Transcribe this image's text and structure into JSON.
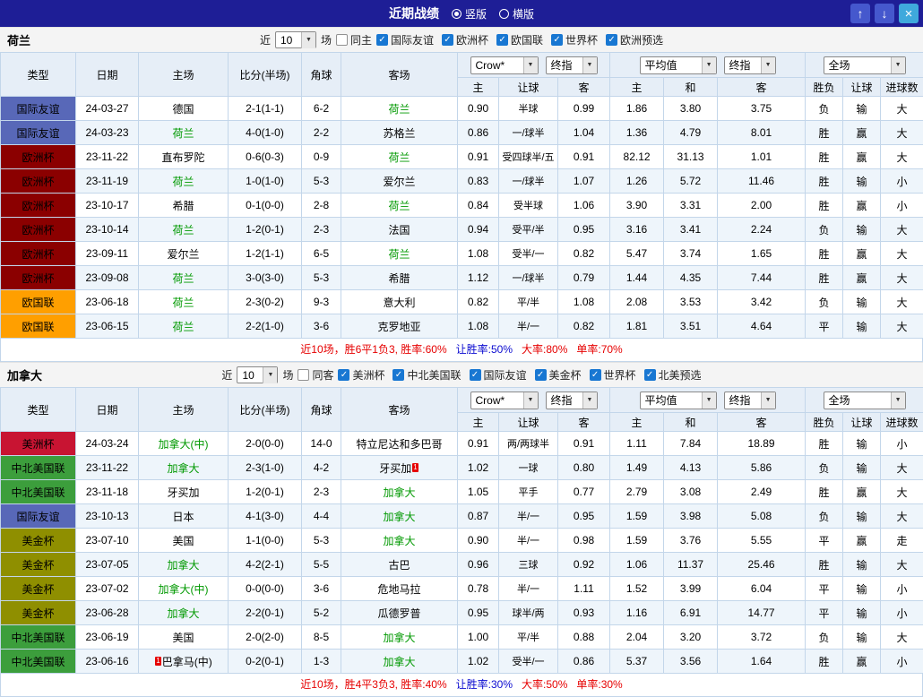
{
  "title_bar": {
    "title": "近期战绩",
    "radio_vertical": "竖版",
    "radio_horizontal": "横版",
    "up": "↑",
    "down": "↓",
    "close": "×"
  },
  "filter": {
    "near": "近",
    "count": "10",
    "matches": "场"
  },
  "table_header": {
    "type": "类型",
    "date": "日期",
    "home": "主场",
    "score": "比分(半场)",
    "corner": "角球",
    "away": "客场",
    "crown_select": "Crow*",
    "final_select": "终指",
    "avg_select": "平均值",
    "fulltime_select": "全场",
    "sub": [
      "主",
      "让球",
      "客",
      "主",
      "和",
      "客",
      "胜负",
      "让球",
      "进球数"
    ]
  },
  "result_colors": {
    "r": "#e60000",
    "b": "#0b0bd0",
    "g": "#0a9b3c"
  },
  "sections": [
    {
      "team": "荷兰",
      "same_side_label": "同主",
      "same_side_checked": false,
      "leagues": [
        "国际友谊",
        "欧洲杯",
        "欧国联",
        "世界杯",
        "欧洲预选"
      ],
      "rows": [
        {
          "league": "国际友谊",
          "color": "#5868b8",
          "date": "24-03-27",
          "home": "德国",
          "score": "2-1(1-1)",
          "corner": "6-2",
          "away": "荷兰",
          "away_focal": true,
          "odds": [
            "0.90",
            "半球",
            "0.99"
          ],
          "avg": [
            "1.86",
            "3.80",
            "3.75"
          ],
          "res": [
            [
              "负",
              "b"
            ],
            [
              "输",
              "b"
            ],
            [
              "大",
              "r"
            ]
          ]
        },
        {
          "league": "国际友谊",
          "color": "#5868b8",
          "date": "24-03-23",
          "home": "荷兰",
          "home_focal": true,
          "score": "4-0(1-0)",
          "corner": "2-2",
          "away": "苏格兰",
          "odds": [
            "0.86",
            "一/球半",
            "1.04"
          ],
          "avg": [
            "1.36",
            "4.79",
            "8.01"
          ],
          "res": [
            [
              "胜",
              "r"
            ],
            [
              "赢",
              "r"
            ],
            [
              "大",
              "r"
            ]
          ]
        },
        {
          "league": "欧洲杯",
          "color": "#8b0000",
          "date": "23-11-22",
          "home": "直布罗陀",
          "score": "0-6(0-3)",
          "corner": "0-9",
          "away": "荷兰",
          "away_focal": true,
          "odds": [
            "0.91",
            "受四球半/五",
            "0.91"
          ],
          "avg": [
            "82.12",
            "31.13",
            "1.01"
          ],
          "res": [
            [
              "胜",
              "r"
            ],
            [
              "赢",
              "r"
            ],
            [
              "大",
              "r"
            ]
          ]
        },
        {
          "league": "欧洲杯",
          "color": "#8b0000",
          "date": "23-11-19",
          "home": "荷兰",
          "home_focal": true,
          "score": "1-0(1-0)",
          "corner": "5-3",
          "away": "爱尔兰",
          "odds": [
            "0.83",
            "一/球半",
            "1.07"
          ],
          "avg": [
            "1.26",
            "5.72",
            "11.46"
          ],
          "res": [
            [
              "胜",
              "r"
            ],
            [
              "输",
              "b"
            ],
            [
              "小",
              "b"
            ]
          ]
        },
        {
          "league": "欧洲杯",
          "color": "#8b0000",
          "date": "23-10-17",
          "home": "希腊",
          "score": "0-1(0-0)",
          "corner": "2-8",
          "away": "荷兰",
          "away_focal": true,
          "odds": [
            "0.84",
            "受半球",
            "1.06"
          ],
          "avg": [
            "3.90",
            "3.31",
            "2.00"
          ],
          "res": [
            [
              "胜",
              "r"
            ],
            [
              "赢",
              "r"
            ],
            [
              "小",
              "b"
            ]
          ]
        },
        {
          "league": "欧洲杯",
          "color": "#8b0000",
          "date": "23-10-14",
          "home": "荷兰",
          "home_focal": true,
          "score": "1-2(0-1)",
          "corner": "2-3",
          "away": "法国",
          "odds": [
            "0.94",
            "受平/半",
            "0.95"
          ],
          "avg": [
            "3.16",
            "3.41",
            "2.24"
          ],
          "res": [
            [
              "负",
              "b"
            ],
            [
              "输",
              "b"
            ],
            [
              "大",
              "r"
            ]
          ]
        },
        {
          "league": "欧洲杯",
          "color": "#8b0000",
          "date": "23-09-11",
          "home": "爱尔兰",
          "score": "1-2(1-1)",
          "corner": "6-5",
          "away": "荷兰",
          "away_focal": true,
          "odds": [
            "1.08",
            "受半/一",
            "0.82"
          ],
          "avg": [
            "5.47",
            "3.74",
            "1.65"
          ],
          "res": [
            [
              "胜",
              "r"
            ],
            [
              "赢",
              "r"
            ],
            [
              "大",
              "r"
            ]
          ]
        },
        {
          "league": "欧洲杯",
          "color": "#8b0000",
          "date": "23-09-08",
          "home": "荷兰",
          "home_focal": true,
          "score": "3-0(3-0)",
          "corner": "5-3",
          "away": "希腊",
          "odds": [
            "1.12",
            "一/球半",
            "0.79"
          ],
          "avg": [
            "1.44",
            "4.35",
            "7.44"
          ],
          "res": [
            [
              "胜",
              "r"
            ],
            [
              "赢",
              "r"
            ],
            [
              "大",
              "r"
            ]
          ]
        },
        {
          "league": "欧国联",
          "color": "#ff9f00",
          "date": "23-06-18",
          "home": "荷兰",
          "home_focal": true,
          "score": "2-3(0-2)",
          "corner": "9-3",
          "away": "意大利",
          "odds": [
            "0.82",
            "平/半",
            "1.08"
          ],
          "avg": [
            "2.08",
            "3.53",
            "3.42"
          ],
          "res": [
            [
              "负",
              "b"
            ],
            [
              "输",
              "b"
            ],
            [
              "大",
              "r"
            ]
          ]
        },
        {
          "league": "欧国联",
          "color": "#ff9f00",
          "date": "23-06-15",
          "home": "荷兰",
          "home_focal": true,
          "score": "2-2(1-0)",
          "corner": "3-6",
          "away": "克罗地亚",
          "odds": [
            "1.08",
            "半/一",
            "0.82"
          ],
          "avg": [
            "1.81",
            "3.51",
            "4.64"
          ],
          "res": [
            [
              "平",
              "g"
            ],
            [
              "输",
              "b"
            ],
            [
              "大",
              "r"
            ]
          ]
        }
      ],
      "summary": [
        {
          "t": "近10场，胜6平1负3, 胜率:60%",
          "c": "r"
        },
        {
          "t": "让胜率:50%",
          "c": "b"
        },
        {
          "t": "大率:80%",
          "c": "r"
        },
        {
          "t": "单率:70%",
          "c": "r"
        }
      ]
    },
    {
      "team": "加拿大",
      "same_side_label": "同客",
      "same_side_checked": false,
      "leagues": [
        "美洲杯",
        "中北美国联",
        "国际友谊",
        "美金杯",
        "世界杯",
        "北美预选"
      ],
      "rows": [
        {
          "league": "美洲杯",
          "color": "#c81432",
          "date": "24-03-24",
          "home": "加拿大(中)",
          "home_focal": true,
          "score": "2-0(0-0)",
          "corner": "14-0",
          "away": "特立尼达和多巴哥",
          "odds": [
            "0.91",
            "两/两球半",
            "0.91"
          ],
          "avg": [
            "1.11",
            "7.84",
            "18.89"
          ],
          "res": [
            [
              "胜",
              "r"
            ],
            [
              "输",
              "b"
            ],
            [
              "小",
              "b"
            ]
          ]
        },
        {
          "league": "中北美国联",
          "color": "#3c9e3c",
          "date": "23-11-22",
          "home": "加拿大",
          "home_focal": true,
          "score": "2-3(1-0)",
          "corner": "4-2",
          "away": "牙买加",
          "away_card": "1",
          "odds": [
            "1.02",
            "一球",
            "0.80"
          ],
          "avg": [
            "1.49",
            "4.13",
            "5.86"
          ],
          "res": [
            [
              "负",
              "b"
            ],
            [
              "输",
              "b"
            ],
            [
              "大",
              "r"
            ]
          ]
        },
        {
          "league": "中北美国联",
          "color": "#3c9e3c",
          "date": "23-11-18",
          "home": "牙买加",
          "score": "1-2(0-1)",
          "corner": "2-3",
          "away": "加拿大",
          "away_focal": true,
          "odds": [
            "1.05",
            "平手",
            "0.77"
          ],
          "avg": [
            "2.79",
            "3.08",
            "2.49"
          ],
          "res": [
            [
              "胜",
              "r"
            ],
            [
              "赢",
              "r"
            ],
            [
              "大",
              "r"
            ]
          ]
        },
        {
          "league": "国际友谊",
          "color": "#5868b8",
          "date": "23-10-13",
          "home": "日本",
          "score": "4-1(3-0)",
          "corner": "4-4",
          "away": "加拿大",
          "away_focal": true,
          "odds": [
            "0.87",
            "半/一",
            "0.95"
          ],
          "avg": [
            "1.59",
            "3.98",
            "5.08"
          ],
          "res": [
            [
              "负",
              "b"
            ],
            [
              "输",
              "b"
            ],
            [
              "大",
              "r"
            ]
          ]
        },
        {
          "league": "美金杯",
          "color": "#8f8f00",
          "date": "23-07-10",
          "home": "美国",
          "score": "1-1(0-0)",
          "corner": "5-3",
          "away": "加拿大",
          "away_focal": true,
          "odds": [
            "0.90",
            "半/一",
            "0.98"
          ],
          "avg": [
            "1.59",
            "3.76",
            "5.55"
          ],
          "res": [
            [
              "平",
              "g"
            ],
            [
              "赢",
              "r"
            ],
            [
              "走",
              "g"
            ]
          ]
        },
        {
          "league": "美金杯",
          "color": "#8f8f00",
          "date": "23-07-05",
          "home": "加拿大",
          "home_focal": true,
          "score": "4-2(2-1)",
          "corner": "5-5",
          "away": "古巴",
          "odds": [
            "0.96",
            "三球",
            "0.92"
          ],
          "avg": [
            "1.06",
            "11.37",
            "25.46"
          ],
          "res": [
            [
              "胜",
              "r"
            ],
            [
              "输",
              "b"
            ],
            [
              "大",
              "r"
            ]
          ]
        },
        {
          "league": "美金杯",
          "color": "#8f8f00",
          "date": "23-07-02",
          "home": "加拿大(中)",
          "home_focal": true,
          "score": "0-0(0-0)",
          "corner": "3-6",
          "away": "危地马拉",
          "odds": [
            "0.78",
            "半/一",
            "1.11"
          ],
          "avg": [
            "1.52",
            "3.99",
            "6.04"
          ],
          "res": [
            [
              "平",
              "g"
            ],
            [
              "输",
              "b"
            ],
            [
              "小",
              "b"
            ]
          ]
        },
        {
          "league": "美金杯",
          "color": "#8f8f00",
          "date": "23-06-28",
          "home": "加拿大",
          "home_focal": true,
          "score": "2-2(0-1)",
          "corner": "5-2",
          "away": "瓜德罗普",
          "odds": [
            "0.95",
            "球半/两",
            "0.93"
          ],
          "avg": [
            "1.16",
            "6.91",
            "14.77"
          ],
          "res": [
            [
              "平",
              "g"
            ],
            [
              "输",
              "b"
            ],
            [
              "小",
              "b"
            ]
          ]
        },
        {
          "league": "中北美国联",
          "color": "#3c9e3c",
          "date": "23-06-19",
          "home": "美国",
          "score": "2-0(2-0)",
          "corner": "8-5",
          "away": "加拿大",
          "away_focal": true,
          "odds": [
            "1.00",
            "平/半",
            "0.88"
          ],
          "avg": [
            "2.04",
            "3.20",
            "3.72"
          ],
          "res": [
            [
              "负",
              "b"
            ],
            [
              "输",
              "b"
            ],
            [
              "大",
              "r"
            ]
          ]
        },
        {
          "league": "中北美国联",
          "color": "#3c9e3c",
          "date": "23-06-16",
          "home": "巴拿马(中)",
          "home_card": "1",
          "score": "0-2(0-1)",
          "corner": "1-3",
          "away": "加拿大",
          "away_focal": true,
          "odds": [
            "1.02",
            "受半/一",
            "0.86"
          ],
          "avg": [
            "5.37",
            "3.56",
            "1.64"
          ],
          "res": [
            [
              "胜",
              "r"
            ],
            [
              "赢",
              "r"
            ],
            [
              "小",
              "b"
            ]
          ]
        }
      ],
      "summary": [
        {
          "t": "近10场，胜4平3负3, 胜率:40%",
          "c": "r"
        },
        {
          "t": "让胜率:30%",
          "c": "b"
        },
        {
          "t": "大率:50%",
          "c": "r"
        },
        {
          "t": "单率:30%",
          "c": "r"
        }
      ]
    }
  ]
}
